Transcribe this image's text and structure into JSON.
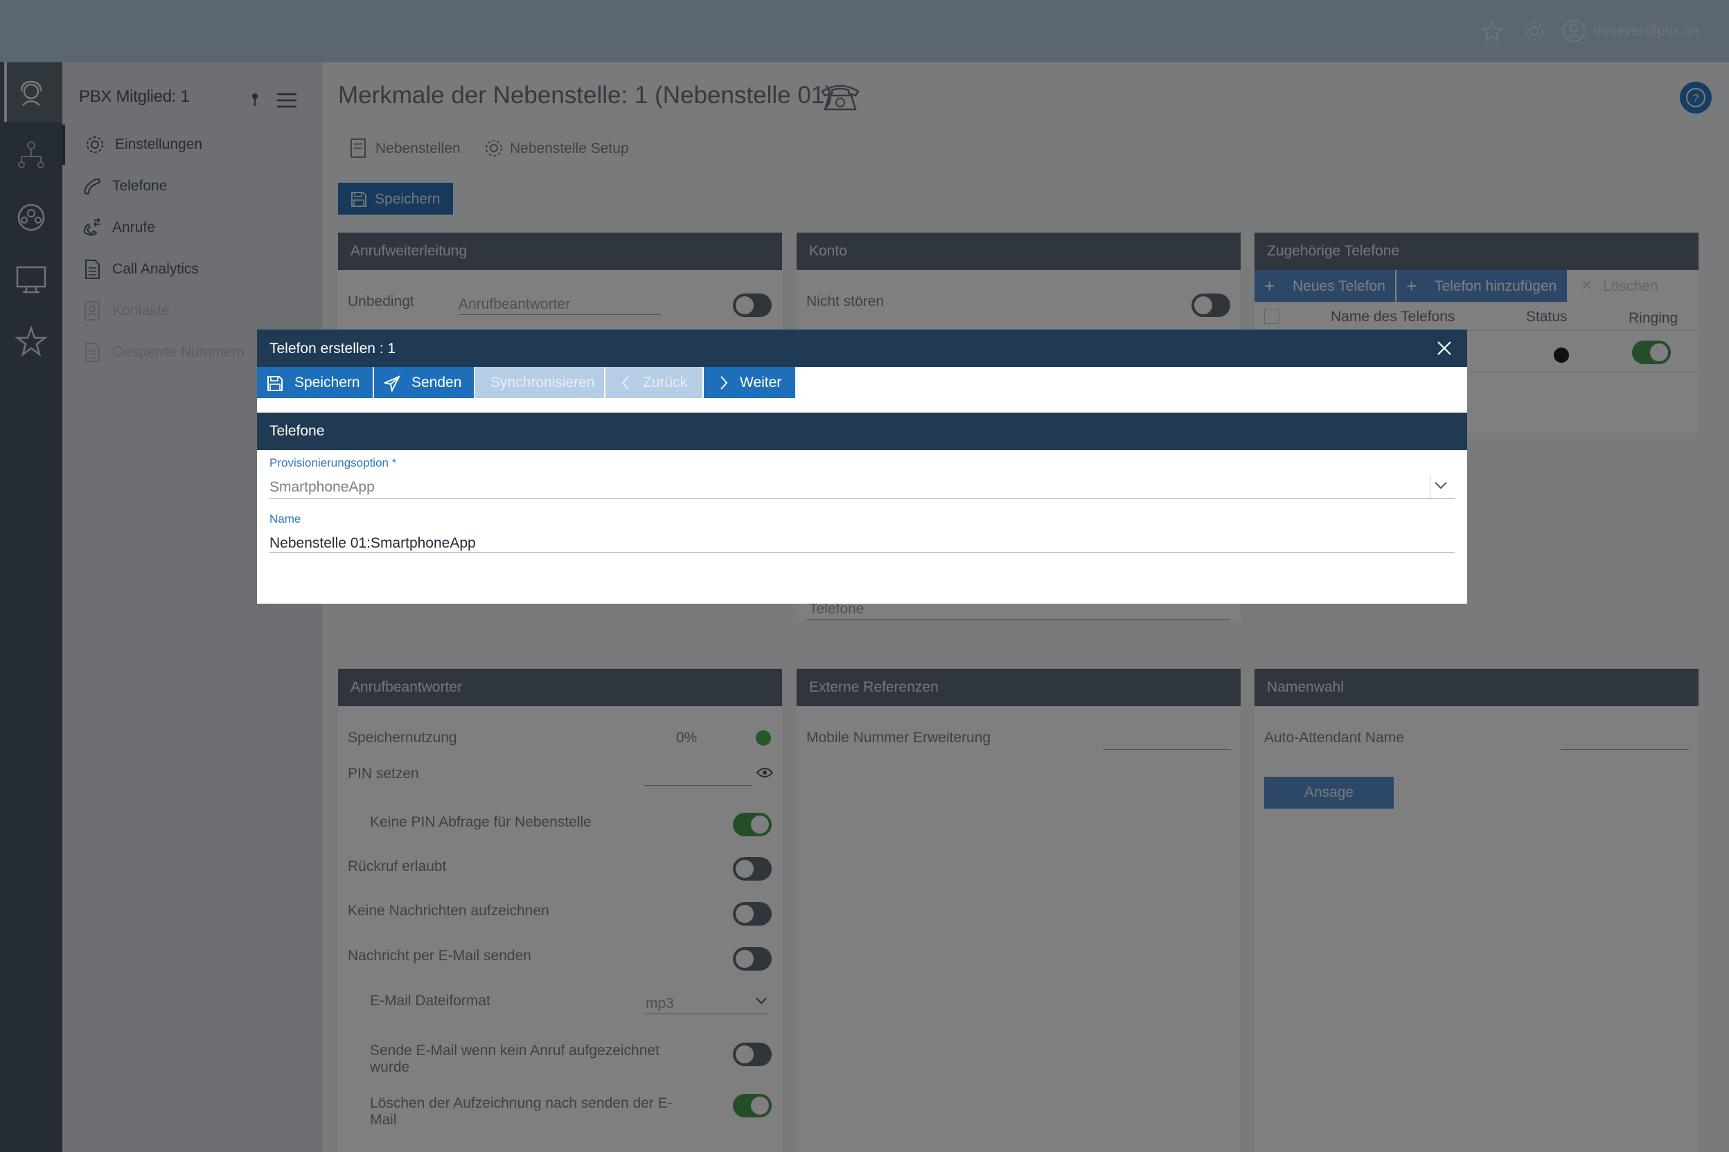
{
  "topbar": {
    "user_name": "mmeyer@pbx.de"
  },
  "rail": {
    "icons": [
      "headset-icon",
      "org-chart-icon",
      "group-icon",
      "monitor-chat-icon",
      "star-icon"
    ]
  },
  "sidebar": {
    "title": "PBX Mitglied: 1",
    "items": [
      {
        "label": "Einstellungen",
        "icon": "gear-icon"
      },
      {
        "label": "Telefone",
        "icon": "handset-icon"
      },
      {
        "label": "Anrufe",
        "icon": "call-arrows-icon"
      },
      {
        "label": "Call Analytics",
        "icon": "document-icon"
      },
      {
        "label": "Kontakte",
        "icon": "contacts-icon"
      },
      {
        "label": "Gesperrte Nummern",
        "icon": "document-icon"
      }
    ]
  },
  "main": {
    "title": "Merkmale der Nebenstelle: 1 (Nebenstelle 01)",
    "tabs": [
      {
        "label": "Nebenstellen"
      },
      {
        "label": "Nebenstelle Setup"
      }
    ],
    "save_label": "Speichern"
  },
  "panels": {
    "anrufweiterleitung": {
      "title": "Anrufweiterleitung",
      "unbedingt_label": "Unbedingt",
      "unbedingt_value": "Anrufbeantworter"
    },
    "konto": {
      "title": "Konto",
      "nicht_stoeren_label": "Nicht stören",
      "telefone_select": "Telefone"
    },
    "zugehoerige": {
      "title": "Zugehörige Telefone",
      "btn_neues": "Neues Telefon",
      "btn_hinzufuegen": "Telefon hinzufügen",
      "btn_loeschen": "Löschen",
      "col_name": "Name des Telefons",
      "col_status": "Status",
      "col_ringing": "Ringing"
    },
    "anrufbeantworter": {
      "title": "Anrufbeantworter",
      "speichernutzung_label": "Speichernutzung",
      "speichernutzung_value": "0%",
      "pin_label": "PIN setzen",
      "keine_pin_label": "Keine PIN Abfrage für Nebenstelle",
      "rueckruf_label": "Rückruf erlaubt",
      "keine_nachrichten_label": "Keine Nachrichten aufzeichnen",
      "email_senden_label": "Nachricht per E-Mail senden",
      "dateiformat_label": "E-Mail Dateiformat",
      "dateiformat_value": "mp3",
      "sende_email_label": "Sende E-Mail wenn kein Anruf aufgezeichnet wurde",
      "loeschen_label": "Löschen der Aufzeichnung nach senden der E-Mail"
    },
    "externe": {
      "title": "Externe Referenzen",
      "mobile_label": "Mobile Nummer Erweiterung"
    },
    "namenwahl": {
      "title": "Namenwahl",
      "auto_label": "Auto-Attendant Name",
      "ansage_label": "Ansage"
    }
  },
  "modal": {
    "title": "Telefon erstellen : 1",
    "buttons": {
      "speichern": "Speichern",
      "senden": "Senden",
      "synchronisieren": "Synchronisieren",
      "zurueck": "Zurück",
      "weiter": "Weiter"
    },
    "section_title": "Telefone",
    "provisioning_label": "Provisionierungsoption *",
    "provisioning_value": "SmartphoneApp",
    "name_label": "Name",
    "name_value": "Nebenstelle 01:SmartphoneApp"
  },
  "colors": {
    "accent": "#1e6fba",
    "modal_header": "#1f3a52",
    "toggle_on": "#4a9a55",
    "disabled_button": "#b6cde6"
  }
}
